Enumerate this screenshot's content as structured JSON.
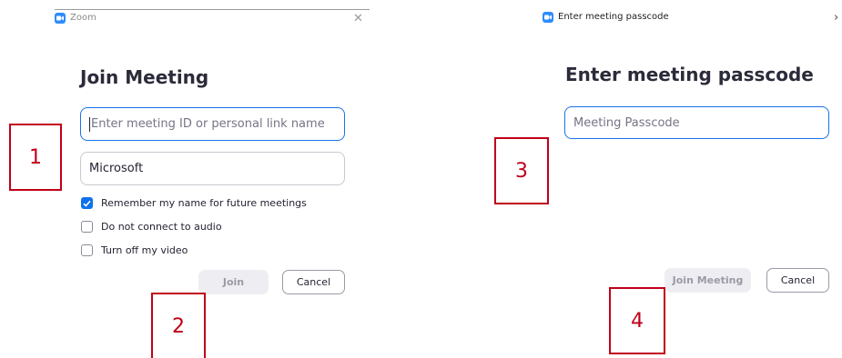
{
  "left_window": {
    "title": "Zoom",
    "close_glyph": "✕",
    "heading": "Join Meeting",
    "meeting_id_placeholder": "Enter meeting ID or personal link name",
    "name_value": "Microsoft",
    "options": [
      {
        "label": "Remember my name for future meetings",
        "checked": true
      },
      {
        "label": "Do not connect to audio",
        "checked": false
      },
      {
        "label": "Turn off my video",
        "checked": false
      }
    ],
    "join_label": "Join",
    "cancel_label": "Cancel"
  },
  "right_window": {
    "title": "Enter meeting passcode",
    "close_glyph": "›",
    "heading": "Enter meeting passcode",
    "passcode_placeholder": "Meeting Passcode",
    "join_label": "Join Meeting",
    "cancel_label": "Cancel"
  },
  "annotations": [
    "1",
    "2",
    "3",
    "4"
  ],
  "colors": {
    "accent": "#0e71eb",
    "annotation": "#c0001a",
    "zoom_brand": "#2d8cff"
  },
  "icons": {
    "app_logo": "zoom-camera-icon",
    "close": "close-icon",
    "check": "checkmark-icon"
  }
}
